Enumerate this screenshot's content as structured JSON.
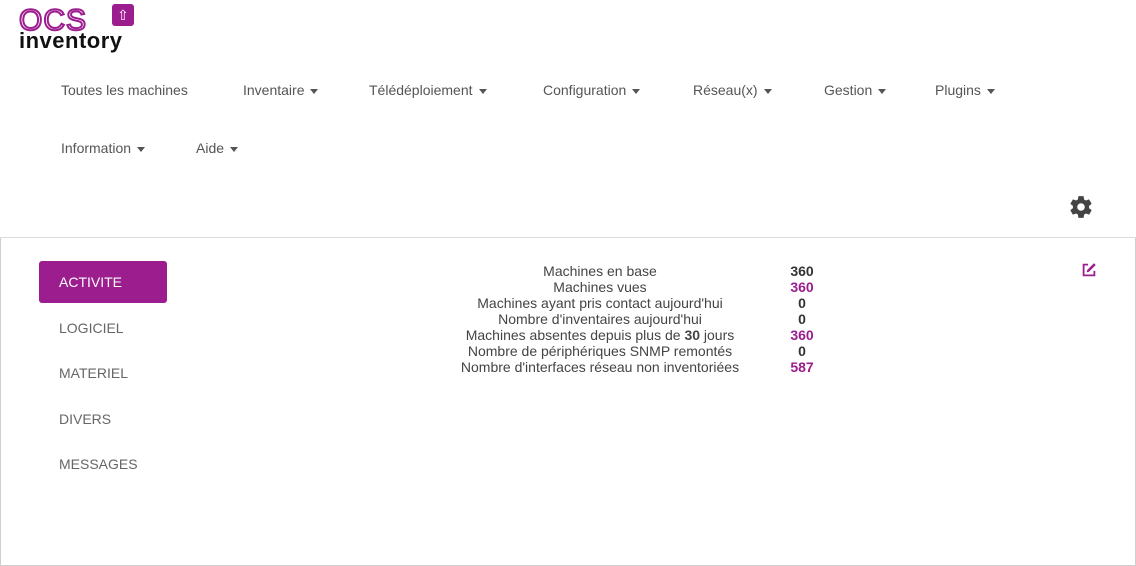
{
  "app": {
    "logo_top": "OCS",
    "logo_bottom": "inventory",
    "accent_color": "#9b1d8e"
  },
  "nav": {
    "items": [
      {
        "label": "Toutes les machines",
        "dropdown": false
      },
      {
        "label": "Inventaire",
        "dropdown": true
      },
      {
        "label": "Télédéploiement",
        "dropdown": true
      },
      {
        "label": "Configuration",
        "dropdown": true
      },
      {
        "label": "Réseau(x)",
        "dropdown": true
      },
      {
        "label": "Gestion",
        "dropdown": true
      },
      {
        "label": "Plugins",
        "dropdown": true
      },
      {
        "label": "Information",
        "dropdown": true
      },
      {
        "label": "Aide",
        "dropdown": true
      }
    ],
    "settings_icon": "gear-icon"
  },
  "sidebar": {
    "items": [
      {
        "label": "ACTIVITE",
        "active": true
      },
      {
        "label": "LOGICIEL",
        "active": false
      },
      {
        "label": "MATERIEL",
        "active": false
      },
      {
        "label": "DIVERS",
        "active": false
      },
      {
        "label": "MESSAGES",
        "active": false
      }
    ]
  },
  "stats": {
    "rows": [
      {
        "label": "Machines en base",
        "value": "360",
        "highlight": false
      },
      {
        "label": "Machines vues",
        "value": "360",
        "highlight": true
      },
      {
        "label": "Machines ayant pris contact aujourd'hui",
        "value": "0",
        "highlight": false
      },
      {
        "label": "Nombre d'inventaires aujourd'hui",
        "value": "0",
        "highlight": false
      },
      {
        "label_before": "Machines absentes depuis plus de ",
        "label_bold": "30",
        "label_after": " jours",
        "value": "360",
        "highlight": true
      },
      {
        "label": "Nombre de périphériques SNMP remontés",
        "value": "0",
        "highlight": false
      },
      {
        "label": "Nombre d'interfaces réseau non inventoriées",
        "value": "587",
        "highlight": true
      }
    ]
  },
  "edit_icon": "edit-icon"
}
